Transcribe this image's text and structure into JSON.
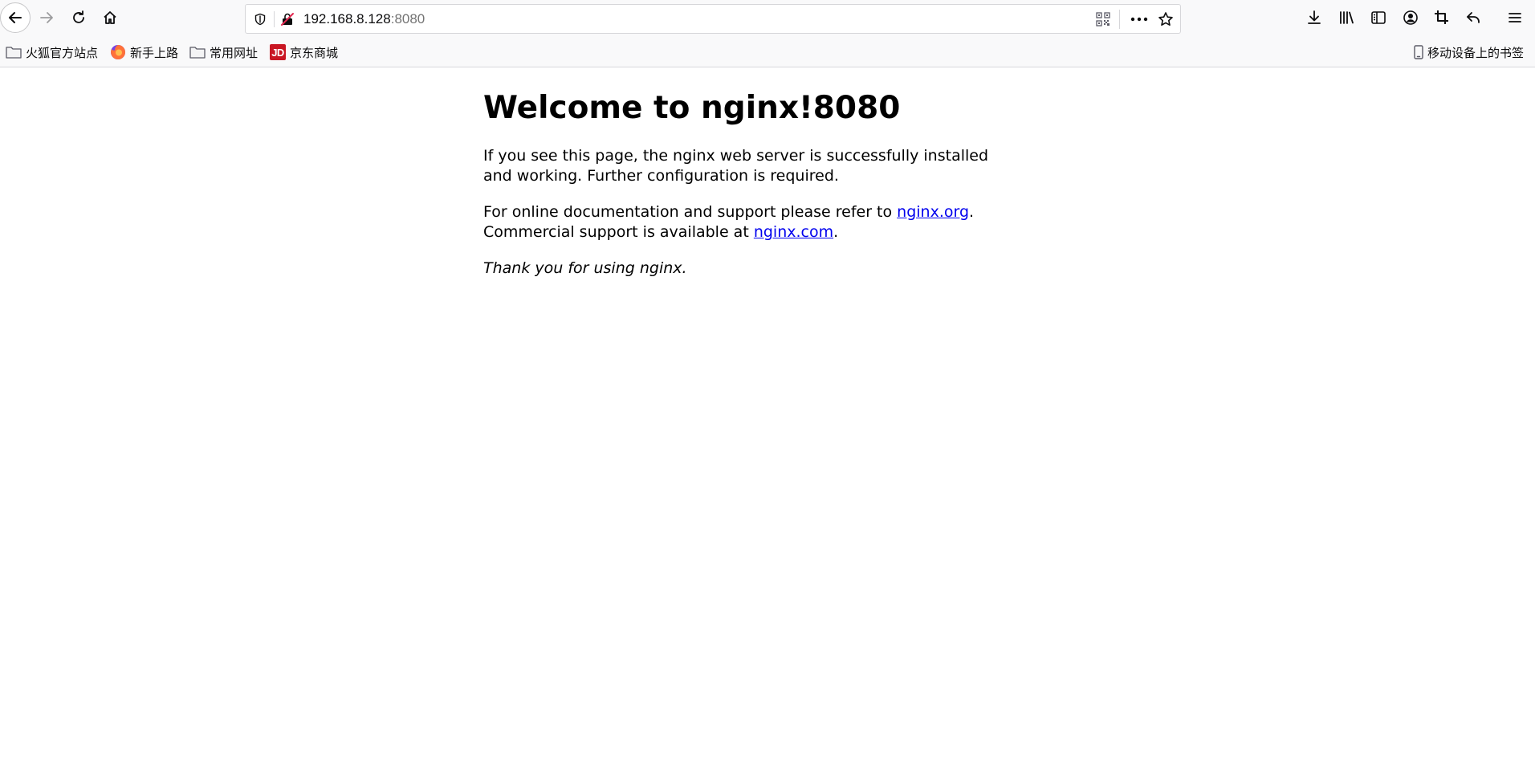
{
  "toolbar": {
    "back_icon": "back-arrow-icon",
    "forward_icon": "forward-arrow-icon",
    "reload_icon": "reload-icon",
    "home_icon": "home-icon",
    "right_icons": [
      "download-icon",
      "library-icon",
      "sidebar-icon",
      "account-icon",
      "screenshot-crop-icon",
      "undo-close-tab-icon",
      "hamburger-menu-icon"
    ]
  },
  "urlbar": {
    "host": "192.168.8.128",
    "port": ":8080",
    "tracking_icon": "tracking-protection-shield-icon",
    "insecure_icon": "insecure-connection-icon",
    "qr_icon": "qr-code-icon",
    "page_actions_icon": "page-actions-icon",
    "bookmark_icon": "bookmark-star-icon"
  },
  "bookmarks": {
    "items": [
      {
        "label": "火狐官方站点",
        "icon": "folder-icon"
      },
      {
        "label": "新手上路",
        "icon": "firefox-logo-icon"
      },
      {
        "label": "常用网址",
        "icon": "folder-icon"
      },
      {
        "label": "京东商城",
        "icon": "jd-logo-icon",
        "badge": "JD"
      }
    ],
    "mobile_label": "移动设备上的书签",
    "mobile_icon": "mobile-device-icon"
  },
  "page": {
    "heading": "Welcome to nginx!8080",
    "para1": "If you see this page, the nginx web server is successfully installed and working. Further configuration is required.",
    "para2_prefix": "For online documentation and support please refer to ",
    "link_org": "nginx.org",
    "para2_mid": ".",
    "para2_line2": "Commercial support is available at ",
    "link_com": "nginx.com",
    "para2_end": ".",
    "thanks": "Thank you for using nginx."
  }
}
